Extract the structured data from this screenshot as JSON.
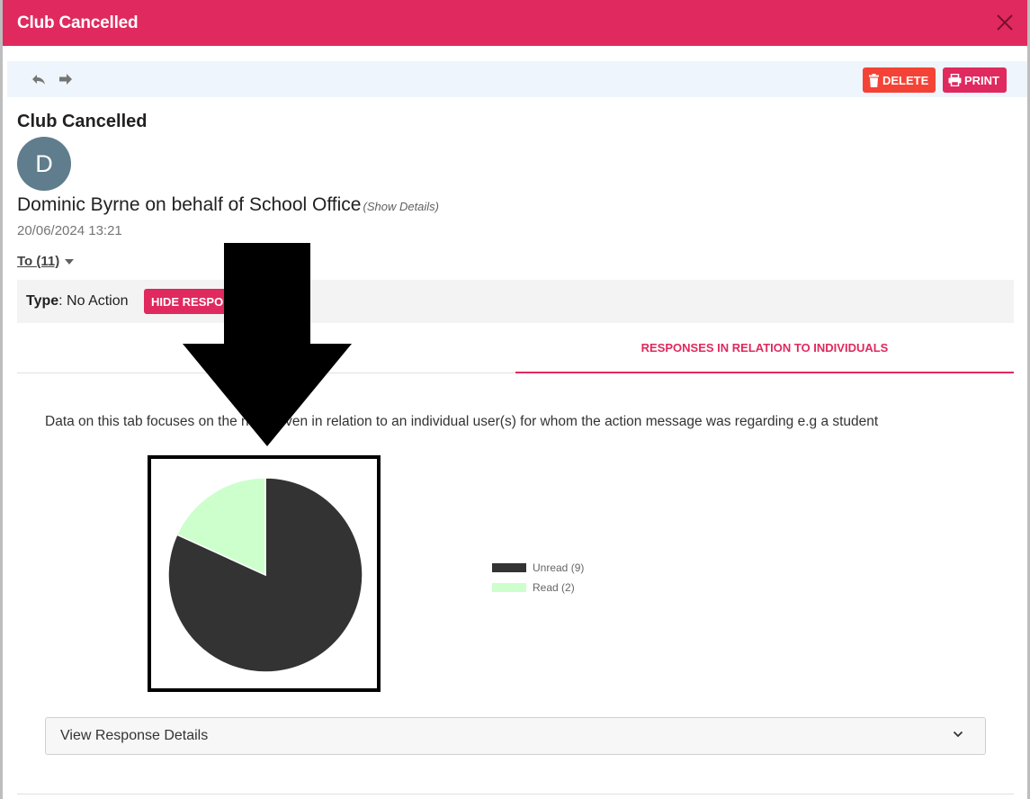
{
  "modal": {
    "title": "Club Cancelled",
    "colors": {
      "brand": "#e0295e",
      "delete": "#f44336",
      "toolbar_bg": "#eef5fc"
    }
  },
  "toolbar": {
    "reply_icon": "reply-icon",
    "forward_icon": "forward-icon",
    "delete_label": "DELETE",
    "print_label": "PRINT"
  },
  "message": {
    "title": "Club Cancelled",
    "avatar_initial": "D",
    "sender": "Dominic Byrne on behalf of School Office",
    "show_details": "(Show Details)",
    "date": "20/06/2024 13:21",
    "to_label": "To (11)",
    "type_label": "Type",
    "type_value": ": No Action",
    "hide_button": "HIDE RESPO"
  },
  "tabs": [
    {
      "label": "",
      "active": false
    },
    {
      "label": "RESPONSES IN RELATION TO INDIVIDUALS",
      "active": true
    }
  ],
  "description": "Data on this tab focuses on the        nses given in relation to an individual user(s) for whom the action message was regarding e.g a student",
  "chart_data": {
    "type": "pie",
    "series": [
      {
        "name": "Unread (9)",
        "value": 9,
        "color": "#333333"
      },
      {
        "name": "Read (2)",
        "value": 2,
        "color": "#ccffcc"
      }
    ],
    "legend_position": "right"
  },
  "accordion": {
    "label": "View Response Details"
  }
}
